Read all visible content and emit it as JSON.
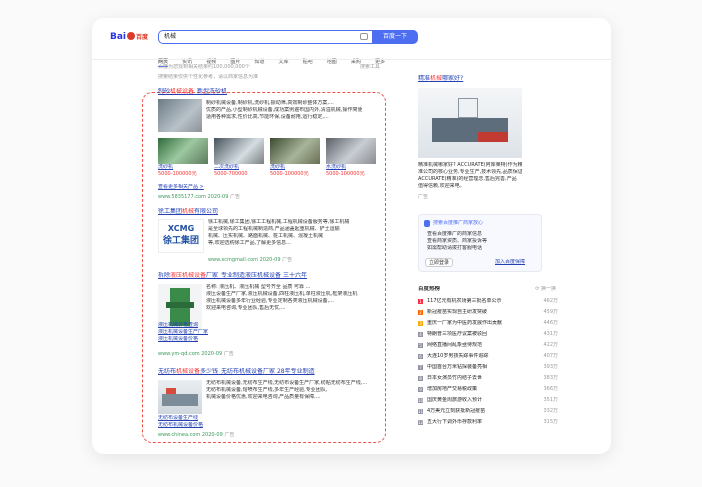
{
  "header": {
    "logo_text": "Bai",
    "logo_text2": "du",
    "logo_cn": "百度",
    "query": "机械",
    "search_button": "百度一下"
  },
  "tabs": [
    "网页",
    "资讯",
    "视频",
    "图片",
    "知道",
    "文库",
    "贴吧",
    "地图",
    "采购",
    "更多"
  ],
  "result_stats": "百度为您找到相关结果约100,000,000个",
  "search_tools": "搜索工具",
  "notice": "搜索结果仅供个性化参考，请以商家信息为准",
  "results": [
    {
      "title_pre": "制砂",
      "title_hit": "机械设备",
      "title_post": "_新型洗砂机",
      "snippet": [
        "制砂机械设备,制砂机,洗砂机,振动筛,高效制砂整体方案,...",
        "优质的产品,小型制砂机械设备,成功案例遍布国内外,清溢机械,操作简便",
        "适用各种需求,性价比高,节能环保,设备耐用,运行稳定,...",
        ""
      ],
      "images": [
        {
          "caption": "洗砂机",
          "price": "5000-100000元"
        },
        {
          "caption": "二次洗砂机",
          "price": "5000-700000"
        },
        {
          "caption": "洗砂机",
          "price": "5000-100000元"
        },
        {
          "caption": "水洗砂机",
          "price": "5000-100000元"
        }
      ],
      "more": "查看更多相关产品 >",
      "meta": "www.5835177.com 2020-09",
      "ad": "广告"
    },
    {
      "title_pre": "徐工集团",
      "title_hit": "机械",
      "title_post": "有限公司",
      "brand": "XCMG",
      "brand_cn": "徐工集团",
      "snippet": [
        "徐工机械,徐工集团,徐工工程机械,工程机械设备服务等,徐工机械",
        "是全球领先的工程机械制造商,产品涵盖起重机械、铲土运输",
        "机械、压实机械、路面机械、桩工机械、混凝土机械",
        "等,欢迎选购徐工产品,了解更多信息..."
      ],
      "meta": "www.xcmgmall.com 2020-09",
      "ad": "广告"
    },
    {
      "title_pre": "拆除",
      "title_hit": "液压机械设备",
      "title_post": "厂家_专业制造液压机械设备 三十六年",
      "snippet": [
        "名称: 液压机、液压机械 型号齐全 品质 可靠 ...",
        "液压设备生产厂家,液压机械设备,四柱液压机,单柱液压机,框架液压机",
        "液压机械设备多年行业经验,专业定制各类液压机械设备,...",
        "欢迎来电咨询,专业团队,售后无忧,...",
        "",
        ""
      ],
      "links": [
        "液压机械价格查询",
        "液压机械设备生产厂家",
        "液压机械设备价格"
      ],
      "meta": "www.ym-qd.com 2020-09",
      "ad": "广告"
    },
    {
      "title_pre": "无纺布",
      "title_hit": "机械设备",
      "title_post": "多少钱_无纺布机械设备厂家 28年专业制造",
      "snippet": [
        "无纺布机械设备,无纺布生产线,无纺布设备生产厂家,纺粘无纺布生产线,...",
        "无纺布机械设备,熔喷布生产线,多年生产经验,专业团队,",
        "机械设备价格优惠,欢迎来电咨询,产品质量有保障,...",
        ""
      ],
      "links": [
        "无纺布设备生产线",
        "无纺布机械设备价格"
      ],
      "meta": "www.chinea.com 2020-09",
      "ad": "广告"
    }
  ],
  "right": {
    "ad_title_pre": "精准",
    "ad_title_hit": "机械",
    "ad_title_post": "哪家好?",
    "ad_snippet": [
      "精准机械哪家好? ACCURATE(阿库莱特)作为精",
      "准公司的核心业务,专业生产,技术领先,品质保证,",
      "ACCURATE(精准)的经营理念,售后完善,产品",
      "值得信赖,欢迎来电。"
    ],
    "ad_label": "广告",
    "guarantee_title": "搜索百度推广商家放心",
    "guarantee_items": [
      "查看百度推广的商家信息",
      "查看商家资质、商家投诉等",
      "如需帮助请拨打客服电话"
    ],
    "login_button": "立即登录",
    "join": "加入百度保障",
    "hot_title": "百度热榜",
    "hot_refresh": "换一换",
    "hot_list": [
      {
        "rank": "1",
        "title": "117亿元有机农场第三批名单公示",
        "count": "462万"
      },
      {
        "rank": "2",
        "title": "新冠疫苗实现自主研发突破",
        "count": "459万"
      },
      {
        "rank": "3",
        "title": "重庆一厂家为中医药发展作出贡献",
        "count": "446万"
      },
      {
        "rank": "4",
        "title": "特朗普三项医疗议案被驳回",
        "count": "431万"
      },
      {
        "rank": "5",
        "title": "网络直播间乱象亟待规范",
        "count": "422万"
      },
      {
        "rank": "6",
        "title": "大连10岁男孩失踪事件追踪",
        "count": "407万"
      },
      {
        "rank": "7",
        "title": "中国首台万米钻探装备亮相",
        "count": "393万"
      },
      {
        "rank": "8",
        "title": "日本女演员竹内结子去世",
        "count": "383万"
      },
      {
        "rank": "9",
        "title": "增加房地产交易税政策",
        "count": "366万"
      },
      {
        "rank": "10",
        "title": "国庆黄金周旅游收入预计",
        "count": "351万"
      },
      {
        "rank": "11",
        "title": "4万美元立刻获批新冠疫苗",
        "count": "332万"
      },
      {
        "rank": "12",
        "title": "五大行下调外币存款利率",
        "count": "315万"
      }
    ]
  },
  "colors": {
    "accent": "#4e6ef2",
    "hit": "#f73131",
    "link": "#2440b3",
    "selection": "#f0534a"
  }
}
